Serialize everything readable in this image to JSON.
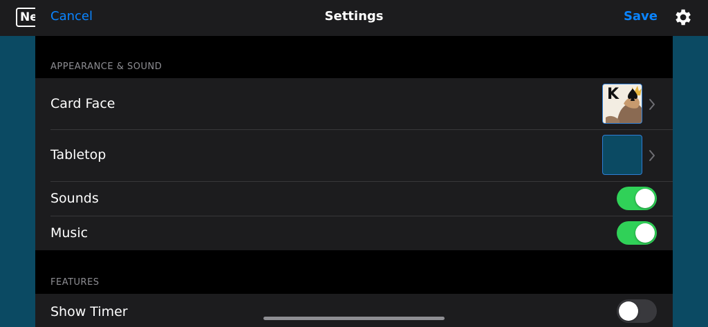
{
  "game": {
    "new_button_label": "New",
    "gear_icon": "gear-icon"
  },
  "nav": {
    "cancel_label": "Cancel",
    "title": "Settings",
    "save_label": "Save"
  },
  "sections": {
    "appearance": {
      "header": "APPEARANCE & SOUND",
      "card_face_label": "Card Face",
      "card_face_preview": "K",
      "tabletop_label": "Tabletop",
      "tabletop_color": "#0b4a63",
      "sounds_label": "Sounds",
      "sounds_on": true,
      "music_label": "Music",
      "music_on": true
    },
    "features": {
      "header": "FEATURES",
      "show_timer_label": "Show Timer",
      "show_timer_on": false
    }
  },
  "colors": {
    "accent": "#0a84ff",
    "toggle_on": "#30d158",
    "toggle_off": "#39393d",
    "row_bg": "#1c1c1e",
    "sheet_bg": "#000000",
    "table_bg": "#0b4a63"
  }
}
